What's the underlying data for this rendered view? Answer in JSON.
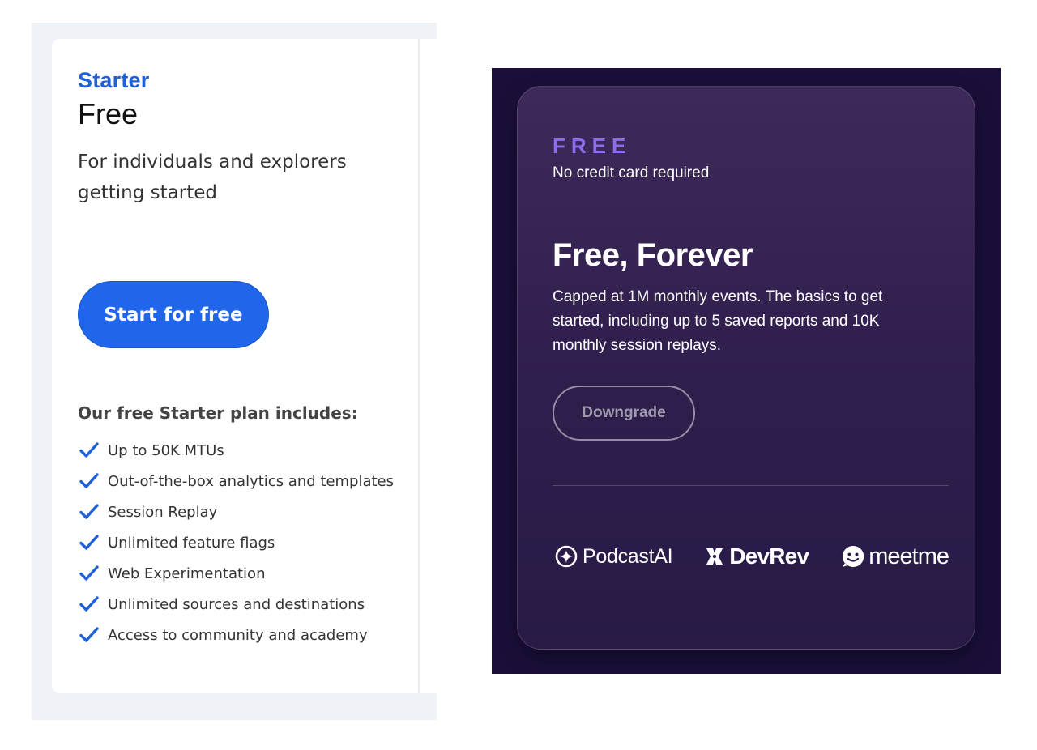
{
  "starter_card": {
    "plan_name": "Starter",
    "price": "Free",
    "description": "For individuals and explorers getting started",
    "cta_label": "Start for free",
    "includes_title": "Our free Starter plan includes:",
    "features": [
      "Up to 50K MTUs",
      "Out-of-the-box analytics and templates",
      "Session Replay",
      "Unlimited feature flags",
      "Web Experimentation",
      "Unlimited sources and destinations",
      "Access to community and academy"
    ],
    "accent_color": "#1f61d8",
    "check_icon": "check-icon"
  },
  "free_card": {
    "label": "FREE",
    "subtitle": "No credit card required",
    "title": "Free, Forever",
    "description": "Capped at 1M monthly events. The basics to get started, including up to 5 saved reports and 10K monthly session replays.",
    "button_label": "Downgrade",
    "logos": [
      "PodcastAI",
      "DevRev",
      "meetme"
    ],
    "label_color": "#8e6cf0",
    "background_color": "#1b0f3a"
  }
}
